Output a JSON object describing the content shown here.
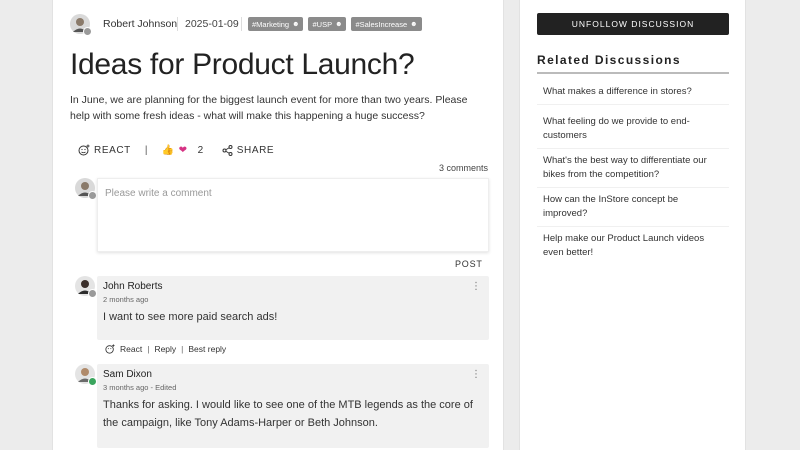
{
  "post": {
    "author": "Robert Johnson",
    "date": "2025-01-09",
    "tags": [
      "#Marketing",
      "#USP",
      "#SalesIncrease"
    ],
    "title": "Ideas for Product Launch?",
    "body": "In June, we are planning for the biggest launch event for more than two years. Please help with some fresh ideas - what will make this happening a huge success?",
    "react_label": "REACT",
    "reaction_count": "2",
    "share_label": "SHARE",
    "comment_count": "3 comments"
  },
  "composer": {
    "placeholder": "Please write a comment",
    "post_label": "POST"
  },
  "comments": [
    {
      "name": "John Roberts",
      "time": "2 months ago",
      "text": "I want to see more paid search ads!",
      "actions": [
        "React",
        "Reply",
        "Best reply"
      ]
    },
    {
      "name": "Sam Dixon",
      "time": "3 months ago - Edited",
      "text": "Thanks for asking. I would like to see one of the MTB legends as the core of the campaign, like Tony Adams-Harper or Beth Johnson."
    }
  ],
  "sidebar": {
    "unfollow_label": "UNFOLLOW DISCUSSION",
    "related_title": "Related Discussions",
    "related": [
      "What makes a difference in stores?",
      "What feeling do we provide to end-customers",
      "What's the best way to differentiate our bikes from the competition?",
      "How can the InStore concept be improved?",
      "Help make our Product Launch videos even better!"
    ]
  },
  "icons": {
    "react": "smile-plus-icon",
    "share": "share-icon",
    "more": "more-vertical-icon",
    "tag_user": "user-icon"
  },
  "colors": {
    "tag_bg": "#8b8b8b",
    "button_dark": "#222222",
    "comment_bg": "#f1f1f1"
  }
}
